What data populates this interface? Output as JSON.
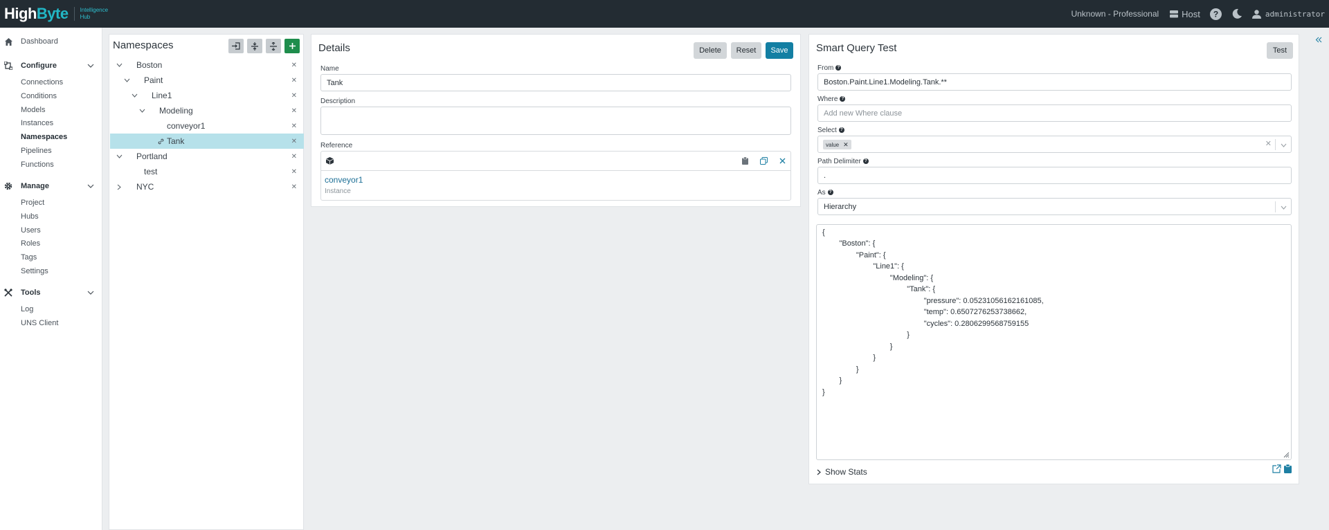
{
  "app": {
    "logo_main": "High",
    "logo_accent": "Byte",
    "logo_sub_line1": "Intelligence",
    "logo_sub_line2": "Hub",
    "license": "Unknown - Professional",
    "host_label": "Host",
    "username": "administrator"
  },
  "sidebar": {
    "dashboard": "Dashboard",
    "configure": {
      "label": "Configure",
      "items": [
        "Connections",
        "Conditions",
        "Models",
        "Instances",
        "Namespaces",
        "Pipelines",
        "Functions"
      ]
    },
    "manage": {
      "label": "Manage",
      "items": [
        "Project",
        "Hubs",
        "Users",
        "Roles",
        "Tags",
        "Settings"
      ]
    },
    "tools": {
      "label": "Tools",
      "items": [
        "Log",
        "UNS Client"
      ]
    },
    "active": "Namespaces"
  },
  "namespaces": {
    "title": "Namespaces",
    "tree": [
      {
        "label": "Boston",
        "expanded": true
      },
      {
        "label": "Paint",
        "expanded": true
      },
      {
        "label": "Line1",
        "expanded": true
      },
      {
        "label": "Modeling",
        "expanded": true
      },
      {
        "label": "conveyor1"
      },
      {
        "label": "Tank",
        "selected": true,
        "linked": true
      },
      {
        "label": "Portland",
        "expanded": true
      },
      {
        "label": "test"
      },
      {
        "label": "NYC",
        "expanded": false
      }
    ]
  },
  "details": {
    "title": "Details",
    "delete_label": "Delete",
    "reset_label": "Reset",
    "save_label": "Save",
    "name_label": "Name",
    "name_value": "Tank",
    "description_label": "Description",
    "description_value": "",
    "reference_label": "Reference",
    "reference_link": "conveyor1",
    "reference_type": "Instance"
  },
  "smart_query": {
    "title": "Smart Query Test",
    "test_label": "Test",
    "from_label": "From",
    "from_value": "Boston.Paint.Line1.Modeling.Tank.**",
    "where_label": "Where",
    "where_placeholder": "Add new Where clause",
    "select_label": "Select",
    "select_tag": "value",
    "path_delimiter_label": "Path Delimiter",
    "path_delimiter_value": ".",
    "as_label": "As",
    "as_value": "Hierarchy",
    "result_lines": [
      "{",
      "        \"Boston\": {",
      "                \"Paint\": {",
      "                        \"Line1\": {",
      "                                \"Modeling\": {",
      "                                        \"Tank\": {",
      "                                                \"pressure\": 0.05231056162161085,",
      "                                                \"temp\": 0.6507276253738662,",
      "                                                \"cycles\": 0.2806299568759155",
      "                                        }",
      "                                }",
      "                        }",
      "                }",
      "        }",
      "}"
    ],
    "show_stats_label": "Show Stats"
  },
  "colors": {
    "topbar": "#232c33",
    "accent_teal": "#22b7c6",
    "save_blue": "#137fa3",
    "add_green": "#1e8d4c",
    "selected_row": "#b6e1ea"
  }
}
